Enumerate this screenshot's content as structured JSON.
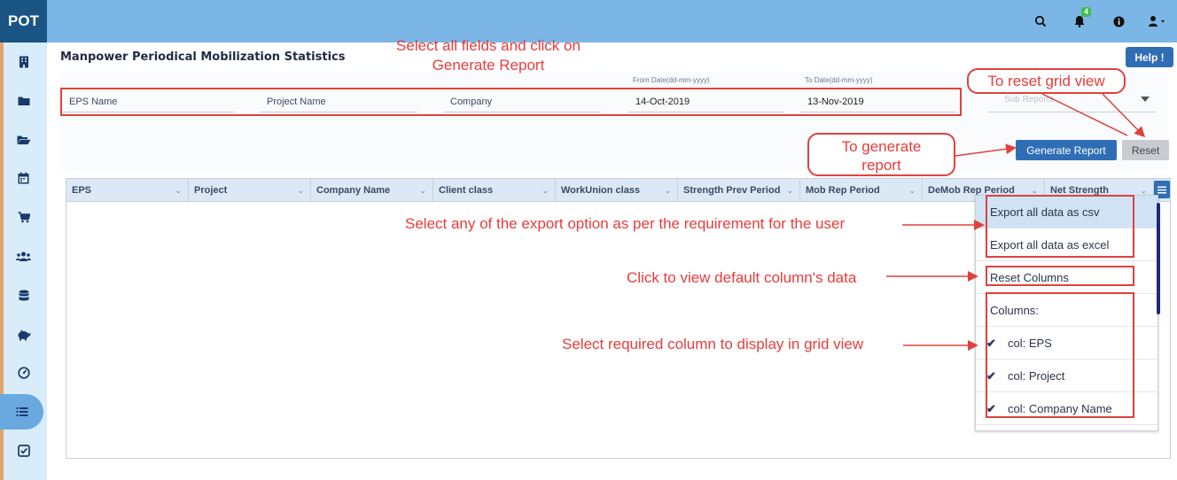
{
  "app": {
    "logo": "POT",
    "notification_count": "4"
  },
  "top_icons": [
    "search-icon",
    "bell-icon",
    "info-icon",
    "user-icon"
  ],
  "sidebar": {
    "items": [
      {
        "icon": "building-icon"
      },
      {
        "icon": "folder-icon"
      },
      {
        "icon": "folder-open-icon"
      },
      {
        "icon": "calendar-icon"
      },
      {
        "icon": "cart-icon"
      },
      {
        "icon": "users-icon"
      },
      {
        "icon": "database-icon"
      },
      {
        "icon": "piggy-bank-icon"
      },
      {
        "icon": "dashboard-icon"
      },
      {
        "icon": "list-icon",
        "active": true
      },
      {
        "icon": "checklist-icon"
      }
    ]
  },
  "page": {
    "title": "Manpower Periodical Mobilization Statistics",
    "help_label": "Help !"
  },
  "filters": {
    "eps_placeholder": "EPS Name",
    "project_placeholder": "Project Name",
    "company_placeholder": "Company",
    "from_label": "From Date(dd-mm-yyyy)",
    "from_value": "14-Oct-2019",
    "to_label": "To Date(dd-mm-yyyy)",
    "to_value": "13-Nov-2019",
    "sub_reports_placeholder": "Sub Reports"
  },
  "buttons": {
    "generate": "Generate Report",
    "reset": "Reset"
  },
  "grid": {
    "columns": [
      "EPS",
      "Project",
      "Company Name",
      "Client class",
      "WorkUnion class",
      "Strength Prev Period",
      "Mob Rep Period",
      "DeMob Rep Period",
      "Net Strength"
    ]
  },
  "column_menu": {
    "export_csv": "Export all data as csv",
    "export_excel": "Export all data as excel",
    "reset_columns": "Reset Columns",
    "columns_heading": "Columns:",
    "col_eps": "col: EPS",
    "col_project": "col: Project",
    "col_company": "col: Company Name"
  },
  "annotations": {
    "select_fields_1": "Select all fields and click on",
    "select_fields_2": "Generate Report",
    "reset_view": "To reset grid view",
    "generate_1": "To generate",
    "generate_2": "report",
    "export_option": "Select any of the export option as per the requirement for the user",
    "default_columns": "Click to view default column's data",
    "select_columns": "Select required column to display in grid view"
  },
  "colors": {
    "accent": "#2f6eb5",
    "topbar": "#7cb6e6",
    "annotation": "#e83c3c"
  }
}
